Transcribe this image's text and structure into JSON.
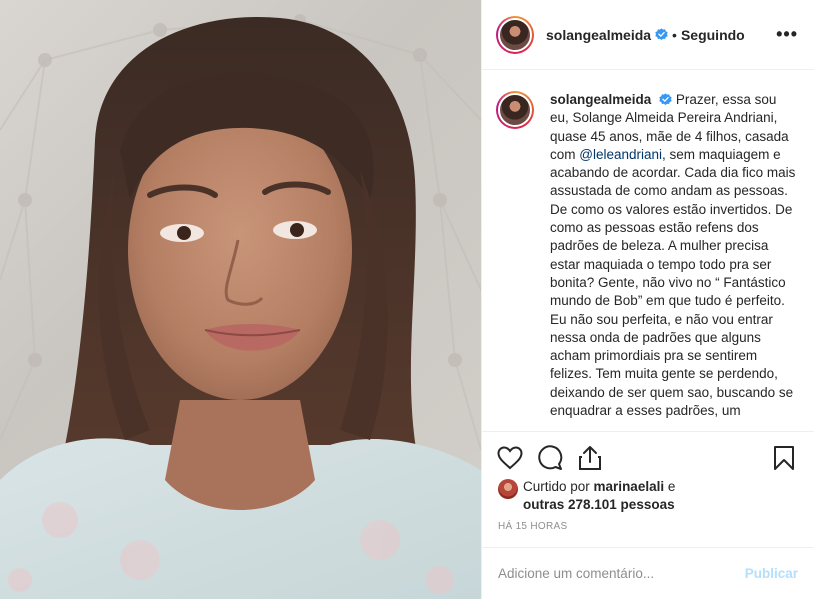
{
  "post": {
    "username": "solangealmeida",
    "separator": "•",
    "following_label": "Seguindo",
    "more_label": "•••"
  },
  "caption": {
    "username": "solangealmeida",
    "text_part1": "Prazer, essa sou eu, Solange Almeida Pereira Andriani, quase 45 anos, mãe de 4 filhos, casada com ",
    "mention": "@leleandriani",
    "text_part2": ", sem maquiagem e acabando de acordar. Cada dia fico mais assustada de como andam as pessoas. De como os valores estão invertidos. De como as pessoas estão refens dos padrões de beleza. A mulher precisa estar maquiada o tempo todo pra ser bonita? Gente, não vivo no “ Fantástico mundo de Bob” em que tudo é perfeito. Eu não sou perfeita, e não vou entrar nessa onda de padrões que alguns acham primordiais pra se sentirem felizes. Tem muita gente se perdendo, deixando de ser quem sao, buscando se enquadrar a esses padrões, um"
  },
  "likes": {
    "prefix": "Curtido por ",
    "first_user": "marinaelali",
    "middle": " e ",
    "others": "outras 278.101 pessoas"
  },
  "timestamp": "HÁ 15 HORAS",
  "comment": {
    "placeholder": "Adicione um comentário...",
    "publish_label": "Publicar"
  },
  "colors": {
    "verified": "#3897f0",
    "mention": "#00376b",
    "publish_disabled": "#b2dffc",
    "muted": "#8e8e8e"
  }
}
